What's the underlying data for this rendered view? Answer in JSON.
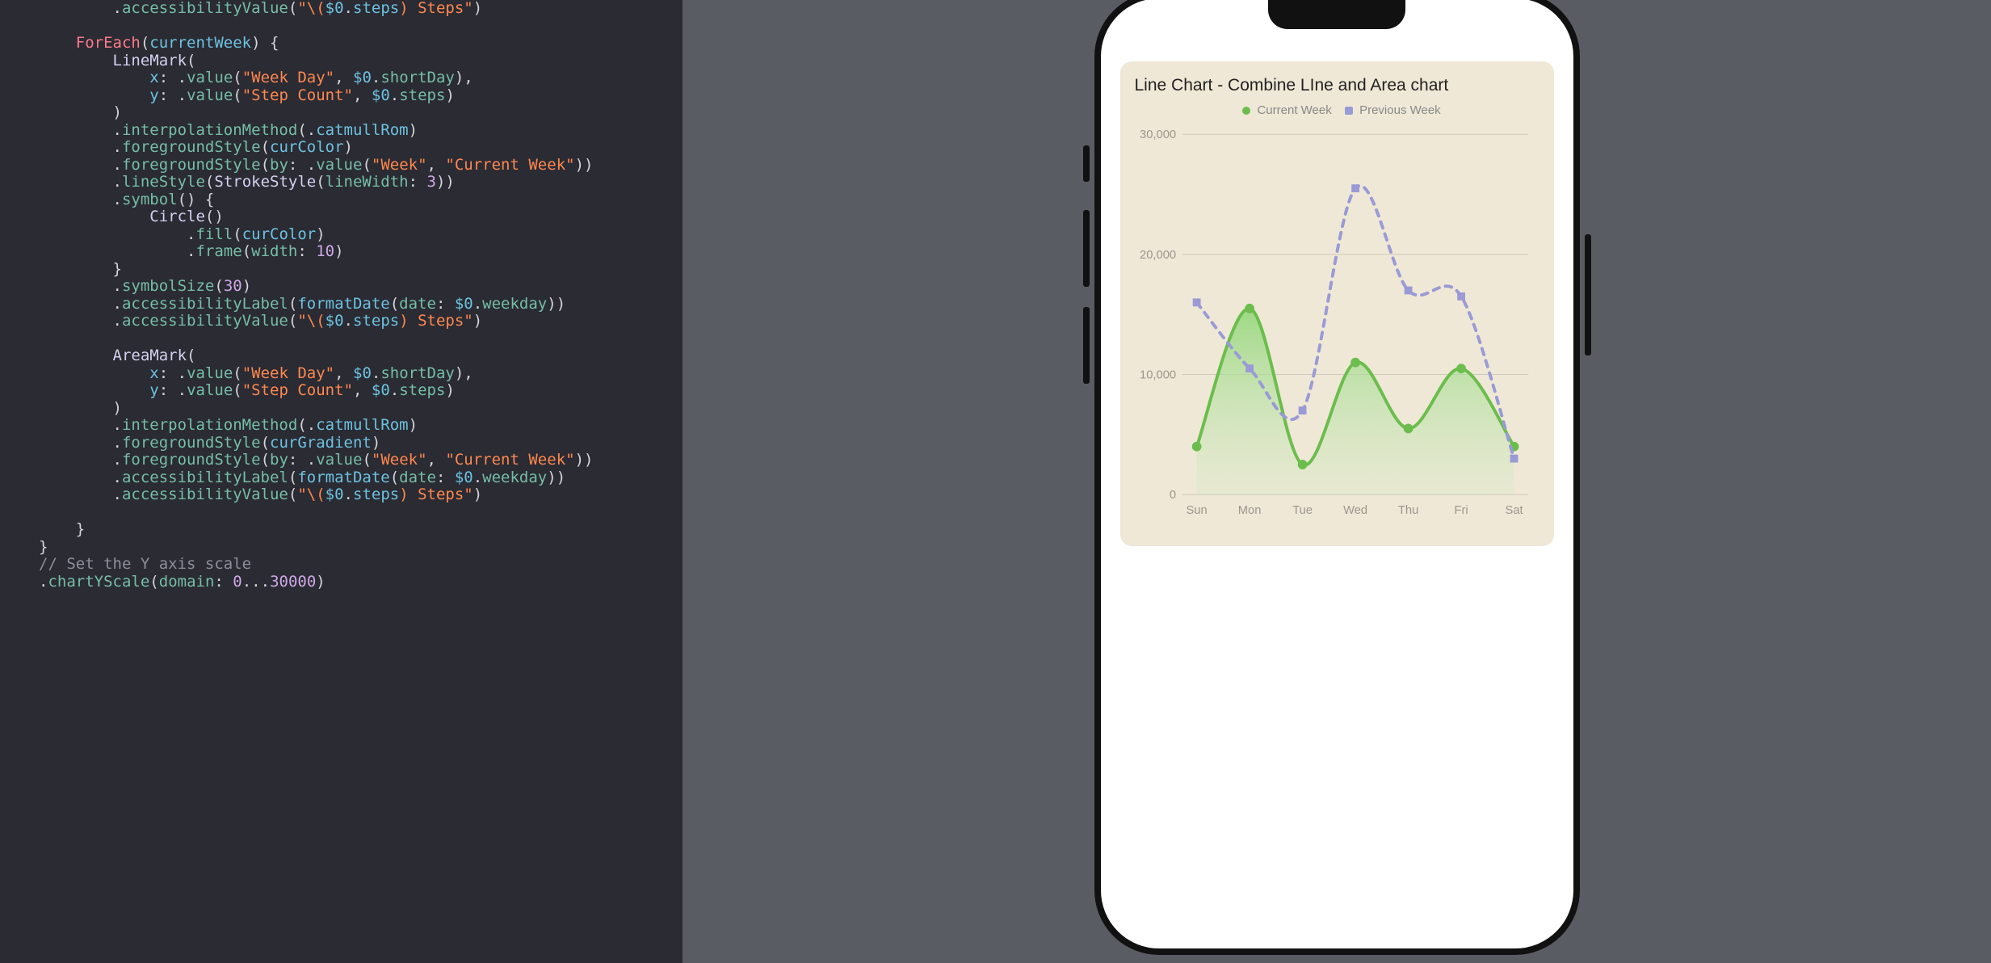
{
  "editor": {
    "lines": [
      [
        [
          2,
          "punc",
          "."
        ],
        [
          2,
          "fn",
          "accessibilityValue"
        ],
        [
          2,
          "punc",
          "("
        ],
        [
          2,
          "str",
          "\"\\("
        ],
        [
          2,
          "id",
          "$0"
        ],
        [
          2,
          "punc",
          "."
        ],
        [
          2,
          "id",
          "steps"
        ],
        [
          2,
          "str",
          ") Steps\""
        ],
        [
          2,
          "punc",
          ")"
        ]
      ],
      [],
      [
        [
          1,
          "kw",
          "ForEach"
        ],
        [
          1,
          "punc",
          "("
        ],
        [
          1,
          "id",
          "currentWeek"
        ],
        [
          1,
          "punc",
          ") {"
        ]
      ],
      [
        [
          2,
          "type",
          "LineMark"
        ],
        [
          2,
          "punc",
          "("
        ]
      ],
      [
        [
          3,
          "id",
          "x"
        ],
        [
          3,
          "punc",
          ": ."
        ],
        [
          3,
          "fn",
          "value"
        ],
        [
          3,
          "punc",
          "("
        ],
        [
          3,
          "str",
          "\"Week Day\""
        ],
        [
          3,
          "punc",
          ", "
        ],
        [
          3,
          "id",
          "$0"
        ],
        [
          3,
          "punc",
          "."
        ],
        [
          3,
          "param",
          "shortDay"
        ],
        [
          3,
          "punc",
          "),"
        ]
      ],
      [
        [
          3,
          "id",
          "y"
        ],
        [
          3,
          "punc",
          ": ."
        ],
        [
          3,
          "fn",
          "value"
        ],
        [
          3,
          "punc",
          "("
        ],
        [
          3,
          "str",
          "\"Step Count\""
        ],
        [
          3,
          "punc",
          ", "
        ],
        [
          3,
          "id",
          "$0"
        ],
        [
          3,
          "punc",
          "."
        ],
        [
          3,
          "param",
          "steps"
        ],
        [
          3,
          "punc",
          ")"
        ]
      ],
      [
        [
          2,
          "punc",
          ")"
        ]
      ],
      [
        [
          2,
          "punc",
          "."
        ],
        [
          2,
          "fn",
          "interpolationMethod"
        ],
        [
          2,
          "punc",
          "(."
        ],
        [
          2,
          "id",
          "catmullRom"
        ],
        [
          2,
          "punc",
          ")"
        ]
      ],
      [
        [
          2,
          "punc",
          "."
        ],
        [
          2,
          "fn",
          "foregroundStyle"
        ],
        [
          2,
          "punc",
          "("
        ],
        [
          2,
          "id",
          "curColor"
        ],
        [
          2,
          "punc",
          ")"
        ]
      ],
      [
        [
          2,
          "punc",
          "."
        ],
        [
          2,
          "fn",
          "foregroundStyle"
        ],
        [
          2,
          "punc",
          "("
        ],
        [
          2,
          "param",
          "by"
        ],
        [
          2,
          "punc",
          ": ."
        ],
        [
          2,
          "fn",
          "value"
        ],
        [
          2,
          "punc",
          "("
        ],
        [
          2,
          "str",
          "\"Week\""
        ],
        [
          2,
          "punc",
          ", "
        ],
        [
          2,
          "str",
          "\"Current Week\""
        ],
        [
          2,
          "punc",
          "))"
        ]
      ],
      [
        [
          2,
          "punc",
          "."
        ],
        [
          2,
          "fn",
          "lineStyle"
        ],
        [
          2,
          "punc",
          "("
        ],
        [
          2,
          "type",
          "StrokeStyle"
        ],
        [
          2,
          "punc",
          "("
        ],
        [
          2,
          "param",
          "lineWidth"
        ],
        [
          2,
          "punc",
          ": "
        ],
        [
          2,
          "num",
          "3"
        ],
        [
          2,
          "punc",
          "))"
        ]
      ],
      [
        [
          2,
          "punc",
          "."
        ],
        [
          2,
          "fn",
          "symbol"
        ],
        [
          2,
          "punc",
          "() {"
        ]
      ],
      [
        [
          3,
          "type",
          "Circle"
        ],
        [
          3,
          "punc",
          "()"
        ]
      ],
      [
        [
          4,
          "punc",
          "."
        ],
        [
          4,
          "fn",
          "fill"
        ],
        [
          4,
          "punc",
          "("
        ],
        [
          4,
          "id",
          "curColor"
        ],
        [
          4,
          "punc",
          ")"
        ]
      ],
      [
        [
          4,
          "punc",
          "."
        ],
        [
          4,
          "fn",
          "frame"
        ],
        [
          4,
          "punc",
          "("
        ],
        [
          4,
          "param",
          "width"
        ],
        [
          4,
          "punc",
          ": "
        ],
        [
          4,
          "num",
          "10"
        ],
        [
          4,
          "punc",
          ")"
        ]
      ],
      [
        [
          2,
          "punc",
          "}"
        ]
      ],
      [
        [
          2,
          "punc",
          "."
        ],
        [
          2,
          "fn",
          "symbolSize"
        ],
        [
          2,
          "punc",
          "("
        ],
        [
          2,
          "num",
          "30"
        ],
        [
          2,
          "punc",
          ")"
        ]
      ],
      [
        [
          2,
          "punc",
          "."
        ],
        [
          2,
          "fn",
          "accessibilityLabel"
        ],
        [
          2,
          "punc",
          "("
        ],
        [
          2,
          "id",
          "formatDate"
        ],
        [
          2,
          "punc",
          "("
        ],
        [
          2,
          "param",
          "date"
        ],
        [
          2,
          "punc",
          ": "
        ],
        [
          2,
          "id",
          "$0"
        ],
        [
          2,
          "punc",
          "."
        ],
        [
          2,
          "param",
          "weekday"
        ],
        [
          2,
          "punc",
          "))"
        ]
      ],
      [
        [
          2,
          "punc",
          "."
        ],
        [
          2,
          "fn",
          "accessibilityValue"
        ],
        [
          2,
          "punc",
          "("
        ],
        [
          2,
          "str",
          "\"\\("
        ],
        [
          2,
          "id",
          "$0"
        ],
        [
          2,
          "punc",
          "."
        ],
        [
          2,
          "id",
          "steps"
        ],
        [
          2,
          "str",
          ") Steps\""
        ],
        [
          2,
          "punc",
          ")"
        ]
      ],
      [],
      [
        [
          2,
          "type",
          "AreaMark"
        ],
        [
          2,
          "punc",
          "("
        ]
      ],
      [
        [
          3,
          "id",
          "x"
        ],
        [
          3,
          "punc",
          ": ."
        ],
        [
          3,
          "fn",
          "value"
        ],
        [
          3,
          "punc",
          "("
        ],
        [
          3,
          "str",
          "\"Week Day\""
        ],
        [
          3,
          "punc",
          ", "
        ],
        [
          3,
          "id",
          "$0"
        ],
        [
          3,
          "punc",
          "."
        ],
        [
          3,
          "param",
          "shortDay"
        ],
        [
          3,
          "punc",
          "),"
        ]
      ],
      [
        [
          3,
          "id",
          "y"
        ],
        [
          3,
          "punc",
          ": ."
        ],
        [
          3,
          "fn",
          "value"
        ],
        [
          3,
          "punc",
          "("
        ],
        [
          3,
          "str",
          "\"Step Count\""
        ],
        [
          3,
          "punc",
          ", "
        ],
        [
          3,
          "id",
          "$0"
        ],
        [
          3,
          "punc",
          "."
        ],
        [
          3,
          "param",
          "steps"
        ],
        [
          3,
          "punc",
          ")"
        ]
      ],
      [
        [
          2,
          "punc",
          ")"
        ]
      ],
      [
        [
          2,
          "punc",
          "."
        ],
        [
          2,
          "fn",
          "interpolationMethod"
        ],
        [
          2,
          "punc",
          "(."
        ],
        [
          2,
          "id",
          "catmullRom"
        ],
        [
          2,
          "punc",
          ")"
        ]
      ],
      [
        [
          2,
          "punc",
          "."
        ],
        [
          2,
          "fn",
          "foregroundStyle"
        ],
        [
          2,
          "punc",
          "("
        ],
        [
          2,
          "id",
          "curGradient"
        ],
        [
          2,
          "punc",
          ")"
        ]
      ],
      [
        [
          2,
          "punc",
          "."
        ],
        [
          2,
          "fn",
          "foregroundStyle"
        ],
        [
          2,
          "punc",
          "("
        ],
        [
          2,
          "param",
          "by"
        ],
        [
          2,
          "punc",
          ": ."
        ],
        [
          2,
          "fn",
          "value"
        ],
        [
          2,
          "punc",
          "("
        ],
        [
          2,
          "str",
          "\"Week\""
        ],
        [
          2,
          "punc",
          ", "
        ],
        [
          2,
          "str",
          "\"Current Week\""
        ],
        [
          2,
          "punc",
          "))"
        ]
      ],
      [
        [
          2,
          "punc",
          "."
        ],
        [
          2,
          "fn",
          "accessibilityLabel"
        ],
        [
          2,
          "punc",
          "("
        ],
        [
          2,
          "id",
          "formatDate"
        ],
        [
          2,
          "punc",
          "("
        ],
        [
          2,
          "param",
          "date"
        ],
        [
          2,
          "punc",
          ": "
        ],
        [
          2,
          "id",
          "$0"
        ],
        [
          2,
          "punc",
          "."
        ],
        [
          2,
          "param",
          "weekday"
        ],
        [
          2,
          "punc",
          "))"
        ]
      ],
      [
        [
          2,
          "punc",
          "."
        ],
        [
          2,
          "fn",
          "accessibilityValue"
        ],
        [
          2,
          "punc",
          "("
        ],
        [
          2,
          "str",
          "\"\\("
        ],
        [
          2,
          "id",
          "$0"
        ],
        [
          2,
          "punc",
          "."
        ],
        [
          2,
          "id",
          "steps"
        ],
        [
          2,
          "str",
          ") Steps\""
        ],
        [
          2,
          "punc",
          ")"
        ]
      ],
      [],
      [
        [
          1,
          "punc",
          "}"
        ]
      ],
      [
        [
          0,
          "punc",
          "}"
        ]
      ],
      [
        [
          0,
          "comment",
          "// Set the Y axis scale"
        ]
      ],
      [
        [
          0,
          "punc",
          "."
        ],
        [
          0,
          "fn",
          "chartYScale"
        ],
        [
          0,
          "punc",
          "("
        ],
        [
          0,
          "param",
          "domain"
        ],
        [
          0,
          "punc",
          ": "
        ],
        [
          0,
          "num",
          "0"
        ],
        [
          0,
          "punc",
          "..."
        ],
        [
          0,
          "num",
          "30000"
        ],
        [
          0,
          "punc",
          ")"
        ]
      ]
    ]
  },
  "preview": {
    "title": "Line Chart - Combine LIne and Area chart",
    "legend": {
      "current": {
        "label": "Current Week",
        "color": "#6bbd4c"
      },
      "previous": {
        "label": "Previous Week",
        "color": "#9a9ad6"
      }
    },
    "y_ticks": [
      "30,000",
      "20,000",
      "10,000",
      "0"
    ]
  },
  "chart_data": {
    "type": "line+area",
    "title": "Line Chart - Combine LIne and Area chart",
    "xlabel": "",
    "ylabel": "",
    "categories": [
      "Sun",
      "Mon",
      "Tue",
      "Wed",
      "Thu",
      "Fri",
      "Sat"
    ],
    "ylim": [
      0,
      30000
    ],
    "grid": true,
    "legend_position": "top",
    "series": [
      {
        "name": "Current Week",
        "color": "#6bbd4c",
        "marker": "circle",
        "dash": false,
        "area": true,
        "values": [
          4000,
          15500,
          2500,
          11000,
          5500,
          10500,
          4000
        ]
      },
      {
        "name": "Previous Week",
        "color": "#9a9ad6",
        "marker": "square",
        "dash": true,
        "area": false,
        "values": [
          16000,
          10500,
          7000,
          25500,
          17000,
          16500,
          3000
        ]
      }
    ]
  }
}
